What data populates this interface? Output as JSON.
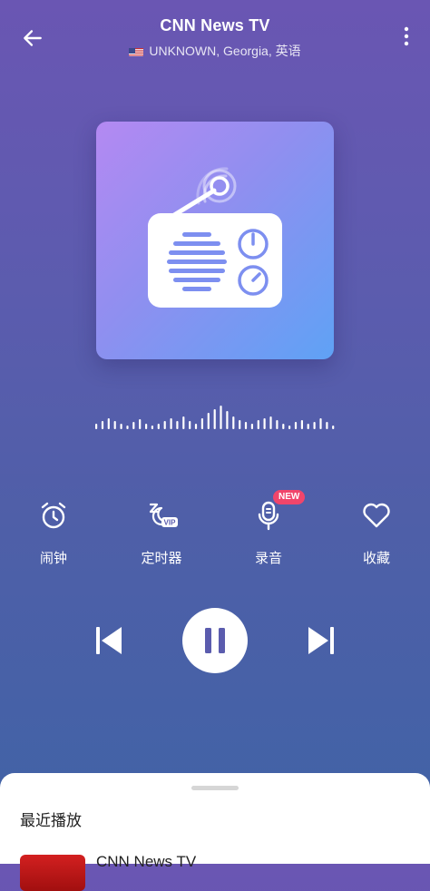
{
  "header": {
    "title": "CNN News TV",
    "subtitle": "UNKNOWN, Georgia, 英语",
    "flag_icon": "us-flag-icon",
    "back_icon": "arrow-left-icon",
    "menu_icon": "more-vertical-icon"
  },
  "artwork": {
    "icon": "radio-icon"
  },
  "features": [
    {
      "label": "闹钟",
      "icon": "alarm-clock-icon"
    },
    {
      "label": "定时器",
      "icon": "sleep-timer-vip-icon",
      "badge_text": "VIP"
    },
    {
      "label": "录音",
      "icon": "microphone-icon",
      "badge": "NEW"
    },
    {
      "label": "收藏",
      "icon": "heart-icon"
    }
  ],
  "controls": {
    "prev_icon": "skip-previous-icon",
    "play_icon": "pause-icon",
    "next_icon": "skip-next-icon",
    "state": "playing"
  },
  "recent": {
    "title": "最近播放",
    "items": [
      {
        "name": "CNN News TV"
      }
    ]
  },
  "colors": {
    "accent": "#f1456b",
    "background_top": "#6a56b3",
    "background_bottom": "#3f63a6"
  }
}
